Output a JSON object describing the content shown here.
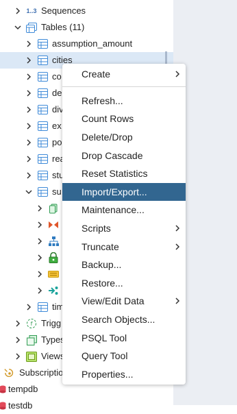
{
  "tree": {
    "items": [
      {
        "label": "Sequences",
        "badge": "1..3",
        "icon": "sequence-icon",
        "expander": "collapsed"
      },
      {
        "label": "Tables (11)",
        "icon": "tables-group-icon",
        "expander": "expanded"
      },
      {
        "label": "assumption_amount",
        "icon": "table-icon",
        "expander": "collapsed"
      },
      {
        "label": "cities",
        "icon": "table-icon",
        "expander": "collapsed",
        "selected": true
      },
      {
        "label": "co",
        "icon": "table-icon",
        "expander": "collapsed"
      },
      {
        "label": "de",
        "icon": "table-icon",
        "expander": "collapsed"
      },
      {
        "label": "div",
        "icon": "table-icon",
        "expander": "collapsed"
      },
      {
        "label": "ex",
        "icon": "table-icon",
        "expander": "collapsed"
      },
      {
        "label": "po",
        "icon": "table-icon",
        "expander": "collapsed"
      },
      {
        "label": "rea",
        "icon": "table-icon",
        "expander": "collapsed"
      },
      {
        "label": "stu",
        "icon": "table-icon",
        "expander": "collapsed"
      },
      {
        "label": "su",
        "icon": "table-icon",
        "expander": "expanded"
      },
      {
        "label": "",
        "icon": "columns-icon",
        "expander": "collapsed"
      },
      {
        "label": "",
        "icon": "constraints-icon",
        "expander": "collapsed"
      },
      {
        "label": "",
        "icon": "indexes-icon",
        "expander": "collapsed"
      },
      {
        "label": "",
        "icon": "rls-policies-icon",
        "expander": "collapsed"
      },
      {
        "label": "",
        "icon": "rules-icon",
        "expander": "collapsed"
      },
      {
        "label": "",
        "icon": "triggers-icon",
        "expander": "collapsed"
      },
      {
        "label": "tim",
        "icon": "table-icon",
        "expander": "collapsed"
      },
      {
        "label": "Trigg",
        "icon": "trigger-functions-icon",
        "expander": "collapsed"
      },
      {
        "label": "Types",
        "icon": "types-icon",
        "expander": "collapsed"
      },
      {
        "label": "Views",
        "icon": "views-icon",
        "expander": "collapsed"
      },
      {
        "label": "Subscriptio",
        "icon": "subscriptions-icon",
        "expander": "none"
      },
      {
        "label": "tempdb",
        "icon": "database-icon",
        "expander": "none"
      },
      {
        "label": "testdb",
        "icon": "database-icon",
        "expander": "none"
      }
    ]
  },
  "context_menu": {
    "items": [
      {
        "label": "Create",
        "submenu": true
      },
      {
        "separator": true
      },
      {
        "label": "Refresh..."
      },
      {
        "label": "Count Rows"
      },
      {
        "label": "Delete/Drop"
      },
      {
        "label": "Drop Cascade"
      },
      {
        "label": "Reset Statistics"
      },
      {
        "label": "Import/Export...",
        "highlighted": true
      },
      {
        "label": "Maintenance..."
      },
      {
        "label": "Scripts",
        "submenu": true
      },
      {
        "label": "Truncate",
        "submenu": true
      },
      {
        "label": "Backup..."
      },
      {
        "label": "Restore..."
      },
      {
        "label": "View/Edit Data",
        "submenu": true
      },
      {
        "label": "Search Objects..."
      },
      {
        "label": "PSQL Tool"
      },
      {
        "label": "Query Tool"
      },
      {
        "label": "Properties..."
      }
    ]
  },
  "colors": {
    "highlight": "#326690",
    "selected_row": "#dbe8f6",
    "table_icon": "#3e8ad8"
  }
}
